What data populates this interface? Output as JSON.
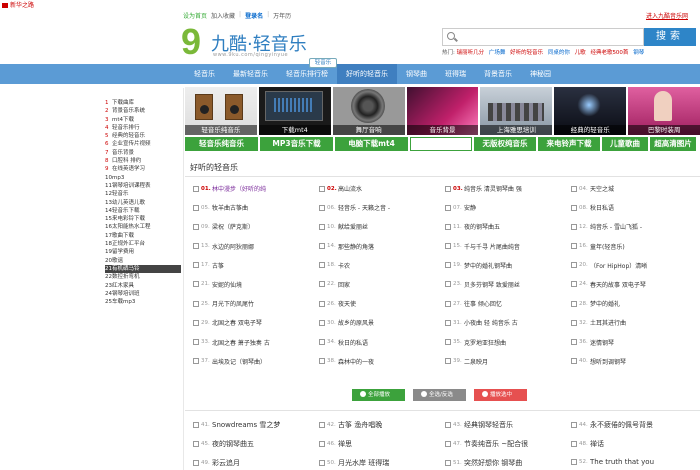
{
  "site": {
    "mini_logo": "新华之路"
  },
  "toplinks": {
    "items": [
      "设为首页",
      "加入收藏",
      "登录名",
      "万年历"
    ],
    "enter": "进入九酷音乐网"
  },
  "logo": {
    "nine": "9",
    "name": "九酷·轻音乐",
    "url": "www.9ku.com/qingyinyue"
  },
  "search": {
    "placeholder": "",
    "button": "搜索",
    "hot_label": "热门:",
    "hot_words": [
      "瑞丽听几分",
      "广场舞",
      "好听的轻音乐",
      "同桌的你",
      "儿歌",
      "经典老歌500首",
      "钢琴"
    ]
  },
  "nav": {
    "items": [
      "轻音乐",
      "最新轻音乐",
      "轻音乐排行榜",
      "好听的轻音乐",
      "钢琴曲",
      "班得瑞",
      "背景音乐",
      "神秘园"
    ],
    "active_index": 3,
    "float_label": "轻音乐"
  },
  "sidebar": {
    "items": [
      {
        "num": "1",
        "label": "下载曲库"
      },
      {
        "num": "2",
        "label": "背景音乐系统"
      },
      {
        "num": "3",
        "label": "mt4下载"
      },
      {
        "num": "4",
        "label": "轻音乐排行"
      },
      {
        "num": "5",
        "label": "经典的轻音乐"
      },
      {
        "num": "6",
        "label": "企业宣传片视频"
      },
      {
        "num": "7",
        "label": "音乐背景"
      },
      {
        "num": "8",
        "label": "口腔科 排约"
      },
      {
        "num": "9",
        "label": "在线英语学习"
      },
      {
        "num": "10",
        "label": "mp3"
      },
      {
        "num": "11",
        "label": "钢琴培训课程表"
      },
      {
        "num": "12",
        "label": "轻音乐"
      },
      {
        "num": "13",
        "label": "幼儿英语儿歌"
      },
      {
        "num": "14",
        "label": "轻音乐下载"
      },
      {
        "num": "15",
        "label": "来电彩铃下载"
      },
      {
        "num": "16",
        "label": "太阳能热水工程"
      },
      {
        "num": "17",
        "label": "歌曲下载"
      },
      {
        "num": "18",
        "label": "正规外汇平台"
      },
      {
        "num": "19",
        "label": "留学费用"
      },
      {
        "num": "20",
        "label": "歌谣"
      },
      {
        "num": "21",
        "label": "有机硒马铃"
      },
      {
        "num": "22",
        "label": "数控折弯机"
      },
      {
        "num": "23",
        "label": "红木家具"
      },
      {
        "num": "24",
        "label": "钢琴培训班"
      },
      {
        "num": "25",
        "label": "车载mp3"
      }
    ],
    "highlight_index": 20
  },
  "banners": [
    {
      "caption": "轻音乐纯音乐"
    },
    {
      "caption": "下载mt4"
    },
    {
      "caption": "舞厅音响"
    },
    {
      "caption": "音乐背景"
    },
    {
      "caption": "上海雅思培训"
    },
    {
      "caption": "经典的轻音乐"
    },
    {
      "caption": "巴黎时装周"
    }
  ],
  "green_buttons": [
    {
      "label": "轻音乐纯音乐",
      "w": 73
    },
    {
      "label": "MP3音乐下载",
      "w": 73
    },
    {
      "label": "电脑下载mt4",
      "w": 73
    },
    {
      "label": "",
      "w": 62,
      "input": true
    },
    {
      "label": "无版权纯音乐",
      "w": 62
    },
    {
      "label": "来电铃声下载",
      "w": 62
    },
    {
      "label": "儿童歌曲",
      "w": 46
    },
    {
      "label": "超高清图片",
      "w": 46
    }
  ],
  "section": {
    "title": "好听的轻音乐"
  },
  "songs": [
    [
      {
        "num": "01.",
        "title": "林中漫步（好听的纯",
        "red": true,
        "purple": true
      },
      {
        "num": "02.",
        "title": "高山流水",
        "red": true
      },
      {
        "num": "03.",
        "title": "纯音乐 清灵钢琴曲 强",
        "red": true
      },
      {
        "num": "04.",
        "title": "天空之城"
      }
    ],
    [
      {
        "num": "05.",
        "title": "牧羊曲古筝曲"
      },
      {
        "num": "06.",
        "title": "轻音乐 - 天籁之音 -"
      },
      {
        "num": "07.",
        "title": "安静"
      },
      {
        "num": "08.",
        "title": "秋日私语"
      }
    ],
    [
      {
        "num": "09.",
        "title": "梁祝（萨克斯）"
      },
      {
        "num": "10.",
        "title": "献给爱丽丝"
      },
      {
        "num": "11.",
        "title": "夜的钢琴曲五"
      },
      {
        "num": "12.",
        "title": "纯音乐 - 雪山飞狐 -"
      }
    ],
    [
      {
        "num": "13.",
        "title": "水边的阿狄丽娜"
      },
      {
        "num": "14.",
        "title": "那些静的角落"
      },
      {
        "num": "15.",
        "title": "千与千寻 片尾曲纯音"
      },
      {
        "num": "16.",
        "title": "童年(轻音乐)"
      }
    ],
    [
      {
        "num": "17.",
        "title": "古筝"
      },
      {
        "num": "18.",
        "title": "卡农"
      },
      {
        "num": "19.",
        "title": "梦中的婚礼钢琴曲"
      },
      {
        "num": "20.",
        "title": "（For HipHop）清晰"
      }
    ],
    [
      {
        "num": "21.",
        "title": "安妮的仙境"
      },
      {
        "num": "22.",
        "title": "回家"
      },
      {
        "num": "23.",
        "title": "贝多芬钢琴 致爱丽丝"
      },
      {
        "num": "24.",
        "title": "春天的故事 双电子琴"
      }
    ],
    [
      {
        "num": "25.",
        "title": "月光下的凤尾竹"
      },
      {
        "num": "26.",
        "title": "夜天使"
      },
      {
        "num": "27.",
        "title": "往事 倾心回忆"
      },
      {
        "num": "28.",
        "title": "梦中的婚礼"
      }
    ],
    [
      {
        "num": "29.",
        "title": "北国之春 双电子琴"
      },
      {
        "num": "30.",
        "title": "故乡的原风景"
      },
      {
        "num": "31.",
        "title": "小夜曲 轻 纯音乐 古"
      },
      {
        "num": "32.",
        "title": "土耳其进行曲"
      }
    ],
    [
      {
        "num": "33.",
        "title": "北国之春 萧子独奏 古"
      },
      {
        "num": "34.",
        "title": "秋日的私语"
      },
      {
        "num": "35.",
        "title": "克罗地亚狂想曲"
      },
      {
        "num": "36.",
        "title": "迷情钢琴"
      }
    ],
    [
      {
        "num": "37.",
        "title": "出埃及记（钢琴曲）"
      },
      {
        "num": "38.",
        "title": "森林中的一夜"
      },
      {
        "num": "39.",
        "title": "二泉映月"
      },
      {
        "num": "40.",
        "title": "想听到调钢琴"
      }
    ]
  ],
  "actions": {
    "play_all": "全部播放",
    "select": "全选/反选",
    "add_list": "播放选中"
  },
  "songs2": [
    [
      {
        "num": "41.",
        "title": "Snowdreams 雪之梦"
      },
      {
        "num": "42.",
        "title": "古筝 渔舟唱晚"
      },
      {
        "num": "43.",
        "title": "经典钢琴轻音乐"
      },
      {
        "num": "44.",
        "title": "永不疲倦的佩号背景"
      }
    ],
    [
      {
        "num": "45.",
        "title": "夜的钢琴曲五"
      },
      {
        "num": "46.",
        "title": "禅思"
      },
      {
        "num": "47.",
        "title": "节奏纯音乐 ~配合很"
      },
      {
        "num": "48.",
        "title": "禅话"
      }
    ],
    [
      {
        "num": "49.",
        "title": "彩云追月"
      },
      {
        "num": "50.",
        "title": "月光水岸 班得瑞"
      },
      {
        "num": "51.",
        "title": "突然好想你 钢琴曲"
      },
      {
        "num": "52.",
        "title": "The truth that you"
      }
    ]
  ]
}
